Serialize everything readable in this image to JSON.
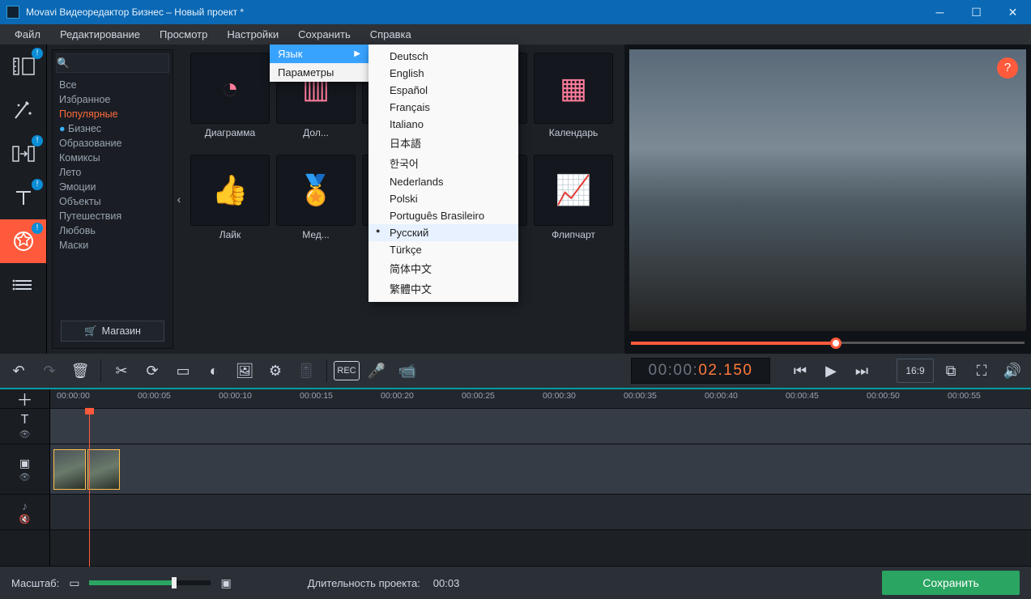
{
  "app": {
    "title": "Movavi Видеоредактор Бизнес – Новый проект *"
  },
  "menubar": [
    "Файл",
    "Редактирование",
    "Просмотр",
    "Настройки",
    "Сохранить",
    "Справка"
  ],
  "settings_menu": {
    "language": "Язык",
    "params": "Параметры"
  },
  "languages": [
    "Deutsch",
    "English",
    "Español",
    "Français",
    "Italiano",
    "日本語",
    "한국어",
    "Nederlands",
    "Polski",
    "Português Brasileiro",
    "Русский",
    "Türkçe",
    "简体中文",
    "繁體中文"
  ],
  "language_selected": "Русский",
  "categories": {
    "search_placeholder": "",
    "items": [
      "Все",
      "Избранное",
      "Популярные",
      "Бизнес",
      "Образование",
      "Комиксы",
      "Лето",
      "Эмоции",
      "Объекты",
      "Путешествия",
      "Любовь",
      "Маски"
    ],
    "active": "Популярные",
    "dotted": "Бизнес",
    "store": "Магазин"
  },
  "gallery": [
    {
      "label": "Диаграмма",
      "icon": "pie"
    },
    {
      "label": "Дол...",
      "icon": "bar"
    },
    {
      "label": "",
      "icon": "diamond"
    },
    {
      "label": "",
      "icon": "percent"
    },
    {
      "label": "Календарь",
      "icon": "calendar"
    },
    {
      "label": "Лайк",
      "icon": "thumb"
    },
    {
      "label": "Мед...",
      "icon": "medal"
    },
    {
      "label": "",
      "icon": "ribbon"
    },
    {
      "label": "",
      "icon": "heart"
    },
    {
      "label": "Флипчарт",
      "icon": "flip"
    }
  ],
  "timecode": {
    "gray": "00:00:",
    "orange": "02.150"
  },
  "aspect": "16:9",
  "ruler_ticks": [
    "00:00:00",
    "00:00:05",
    "00:00:10",
    "00:00:15",
    "00:00:20",
    "00:00:25",
    "00:00:30",
    "00:00:35",
    "00:00:40",
    "00:00:45",
    "00:00:50",
    "00:00:55"
  ],
  "bottom": {
    "zoom_label": "Масштаб:",
    "duration_label": "Длительность проекта:",
    "duration_value": "00:03",
    "save": "Сохранить"
  }
}
